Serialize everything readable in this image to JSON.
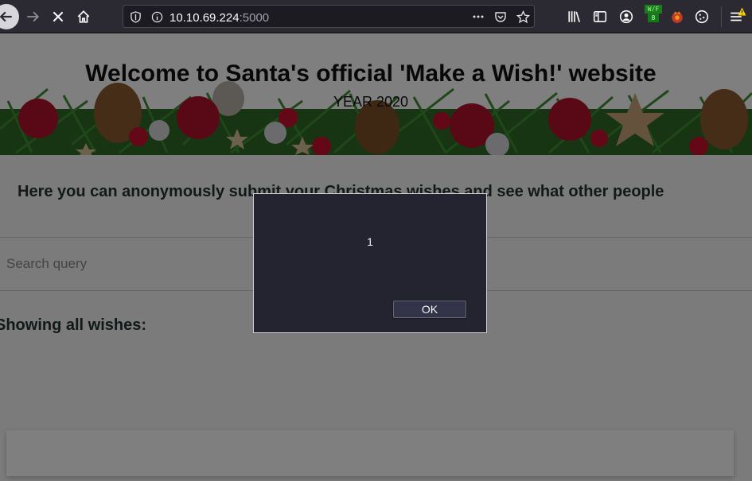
{
  "browser": {
    "url_host": "10.10.69.224",
    "url_port": ":5000",
    "icons": [
      "back-arrow-icon",
      "forward-arrow-icon",
      "stop-icon",
      "home-icon",
      "tracking-shield-icon",
      "info-icon",
      "more-dots-icon",
      "pocket-icon",
      "bookmark-star-icon",
      "library-icon",
      "reader-sidebar-icon",
      "account-icon",
      "wappalyzer-icon",
      "foxyproxy-icon",
      "cookie-icon",
      "menu-icon"
    ],
    "extension_badge": {
      "label": "W/F",
      "count": "8"
    }
  },
  "page": {
    "title": "Welcome to Santa's official 'Make a Wish!' website",
    "year": "YEAR 2020",
    "intro": "Here you can anonymously submit your Christmas wishes and see what other people",
    "search_placeholder": "Search query",
    "wishes_heading": "Showing all wishes:"
  },
  "dialog": {
    "message": "1",
    "ok_label": "OK"
  },
  "colors": {
    "toolbar": "#2b2a33",
    "dialog_bg": "#23242f",
    "ornament_red": "#b3122a",
    "pine_green": "#2f7a2a"
  }
}
